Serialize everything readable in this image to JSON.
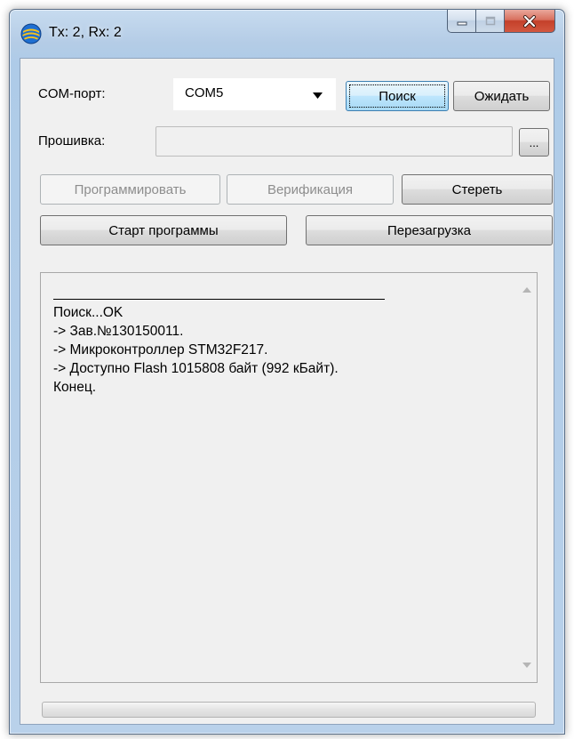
{
  "window": {
    "title": "Tx: 2, Rx: 2",
    "accent_color": "#c4402a",
    "app_icon": "globe-icon"
  },
  "controls": {
    "com_port_label": "COM-порт:",
    "com_port_value": "COM5",
    "search_button": "Поиск",
    "wait_button": "Ожидать",
    "firmware_label": "Прошивка:",
    "firmware_value": "",
    "browse_button": "...",
    "program_button": "Программировать",
    "verify_button": "Верификация",
    "erase_button": "Стереть",
    "start_program_button": "Старт программы",
    "reboot_button": "Перезагрузка"
  },
  "log": {
    "lines": [
      "Поиск...OK",
      "-> Зав.№130150011.",
      "-> Микроконтроллер STM32F217.",
      "-> Доступно Flash 1015808 байт (992 кБайт).",
      "Конец."
    ]
  },
  "progress": {
    "percent": 0
  }
}
